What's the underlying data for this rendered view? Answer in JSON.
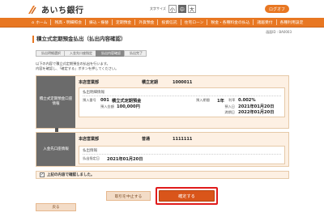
{
  "header": {
    "bank_name": "あいち銀行",
    "font_size_label": "文字サイズ",
    "font_sizes": [
      "小",
      "中",
      "大"
    ],
    "logout": "ログオフ",
    "brand_color": "#e87722"
  },
  "nav": [
    {
      "icon": "home-icon",
      "label": "ホーム"
    },
    {
      "label": "残高・明細照会"
    },
    {
      "label": "振込・振替"
    },
    {
      "label": "定期預金"
    },
    {
      "label": "外貨預金"
    },
    {
      "label": "投資信託"
    },
    {
      "label": "住宅ローン"
    },
    {
      "label": "税金・各種料金の払込"
    },
    {
      "label": "諸届受付"
    },
    {
      "label": "各種利用設定"
    }
  ],
  "screen_id": "画面ID : BA0003",
  "page_title": "積立式定期預金払出（払出内容確認）",
  "steps": [
    "払出明細選択",
    "入金先口座指定",
    "払出内容確認",
    "払出完了"
  ],
  "description": [
    "以下の内容で積立式定期預金の払出を行います。",
    "内容を確認し、「確定する」ボタンを押してください。"
  ],
  "source_panel": {
    "label": "積立式定期預金口座情報",
    "branch": "本店営業部",
    "account_type": "積立定期",
    "account_no": "1000011",
    "detail_title": "払出明細情報",
    "item_label": "預入番号",
    "item_no": "001",
    "item_type": "積立式定期預金",
    "rate_label": "預入期間",
    "period": "1年",
    "rate_type": "利率",
    "rate": "0.002%",
    "amount_label": "預入金額",
    "amount": "100,000円",
    "start_label": "預入日",
    "start_date": "2021年01月20日",
    "maturity_label": "満期日",
    "maturity_date": "2022年01月20日"
  },
  "dest_panel": {
    "label": "入金先口座情報",
    "branch": "本店営業部",
    "account_type": "普通",
    "account_no": "1111111",
    "detail_title": "払出情報",
    "date_label": "払出指定日",
    "date": "2021年01月20日"
  },
  "confirm_text": "上記の内容で確認しました。",
  "buttons": {
    "cancel": "取引を中止する",
    "ok": "確定する",
    "back": "戻る"
  }
}
